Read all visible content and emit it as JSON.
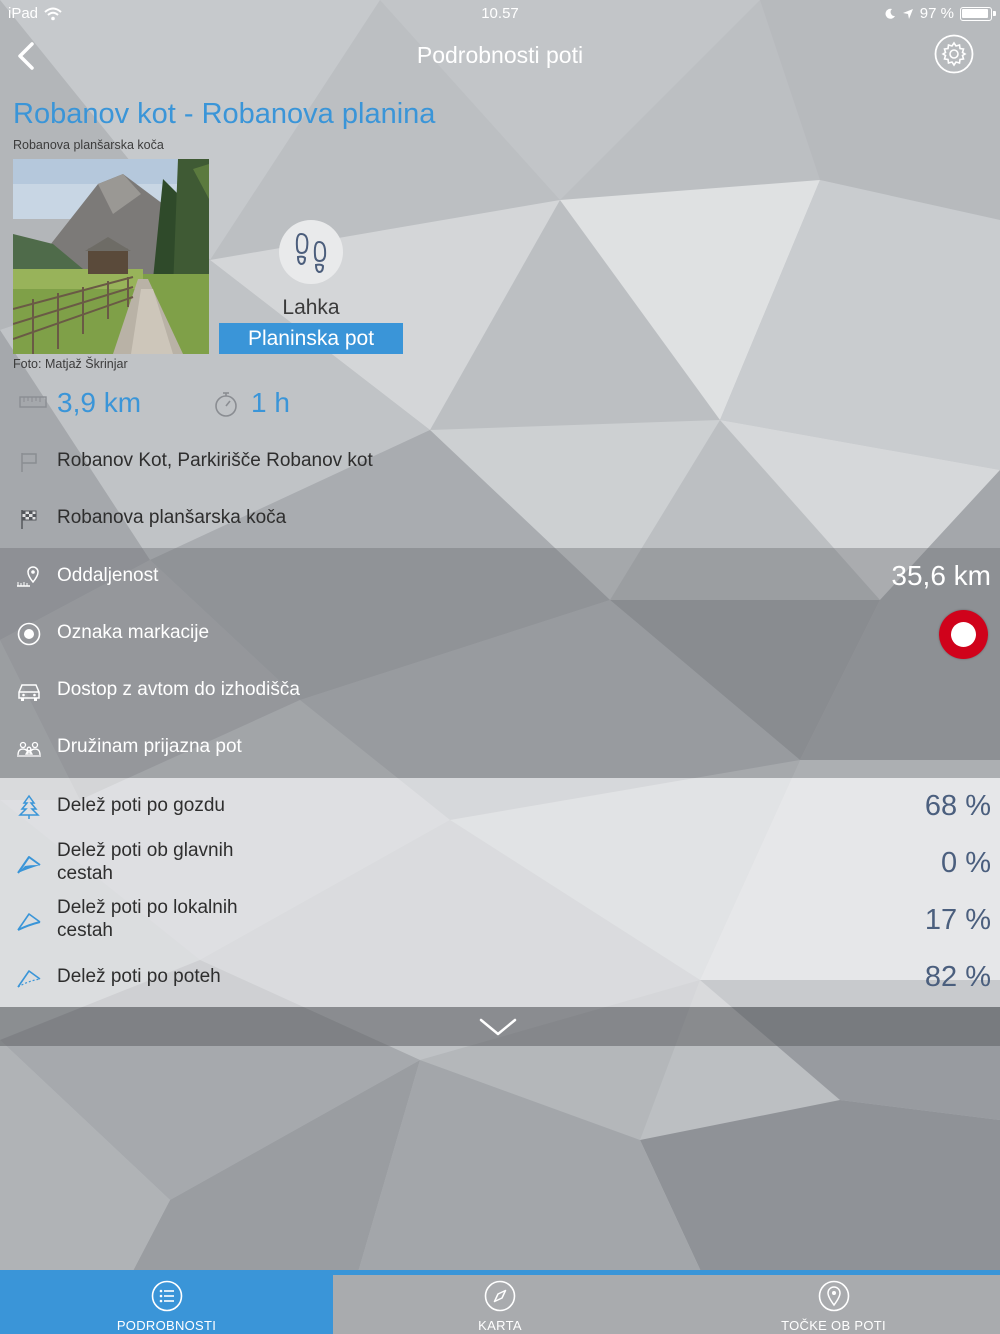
{
  "status_bar": {
    "device": "iPad",
    "time": "10.57",
    "battery": "97 %"
  },
  "nav": {
    "title": "Podrobnosti poti"
  },
  "trail": {
    "title": "Robanov kot - Robanova planina",
    "subtitle": "Robanova planšarska koča",
    "photo_credit": "Foto: Matjaž Škrinjar",
    "difficulty": "Lahka",
    "type": "Planinska pot",
    "length": "3,9 km",
    "duration": "1 h",
    "start": "Robanov Kot, Parkirišče Robanov kot",
    "end": "Robanova planšarska koča"
  },
  "info_rows": [
    {
      "label": "Oddaljenost",
      "value": "35,6 km",
      "icon": "distance-pin-icon"
    },
    {
      "label": "Oznaka markacije",
      "value": "",
      "icon": "marking-target-icon"
    },
    {
      "label": "Dostop z avtom do izhodišča",
      "value": "",
      "icon": "car-icon"
    },
    {
      "label": "Družinam prijazna pot",
      "value": "",
      "icon": "family-icon"
    }
  ],
  "share_rows": [
    {
      "label": "Delež poti po gozdu",
      "value": "68 %",
      "icon": "tree-icon"
    },
    {
      "label": "Delež poti ob glavnih cestah",
      "value": "0 %",
      "icon": "main-road-icon"
    },
    {
      "label": "Delež poti po lokalnih cestah",
      "value": "17 %",
      "icon": "local-road-icon"
    },
    {
      "label": "Delež poti po poteh",
      "value": "82 %",
      "icon": "path-icon"
    }
  ],
  "tabs": [
    {
      "label": "PODROBNOSTI",
      "icon": "list-icon",
      "active": true
    },
    {
      "label": "KARTA",
      "icon": "compass-icon",
      "active": false
    },
    {
      "label": "TOČKE OB POTI",
      "icon": "map-pin-icon",
      "active": false
    }
  ],
  "colors": {
    "accent": "#3a95d8",
    "marking_red": "#d0021b",
    "value_navy": "#4b5f7e"
  }
}
